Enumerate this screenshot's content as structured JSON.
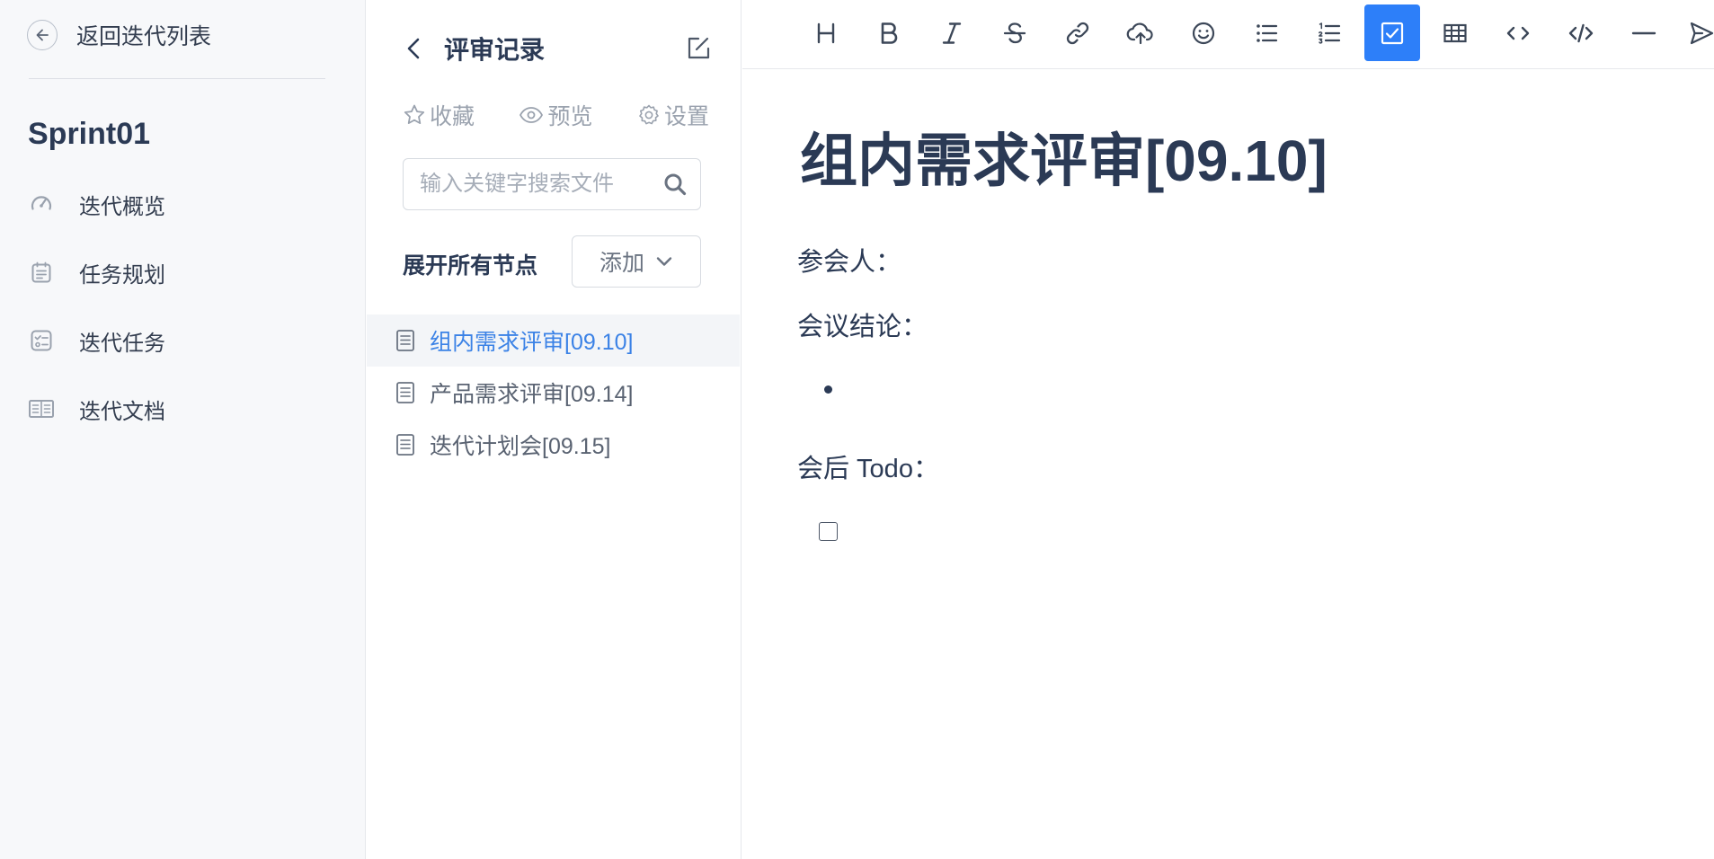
{
  "sidebar": {
    "back_label": "返回迭代列表",
    "sprint_title": "Sprint01",
    "items": [
      {
        "label": "迭代概览",
        "icon": "gauge-icon"
      },
      {
        "label": "任务规划",
        "icon": "calendar-list-icon"
      },
      {
        "label": "迭代任务",
        "icon": "checklist-icon"
      },
      {
        "label": "迭代文档",
        "icon": "book-icon"
      }
    ]
  },
  "tree_panel": {
    "title": "评审记录",
    "actions": {
      "favorite": "收藏",
      "preview": "预览",
      "settings": "设置"
    },
    "search": {
      "placeholder": "输入关键字搜索文件",
      "value": ""
    },
    "expand_all": "展开所有节点",
    "add_button": "添加",
    "documents": [
      {
        "title": "组内需求评审[09.10]",
        "active": true
      },
      {
        "title": "产品需求评审[09.14]",
        "active": false
      },
      {
        "title": "迭代计划会[09.15]",
        "active": false
      }
    ]
  },
  "toolbar": {
    "buttons": [
      "heading",
      "bold",
      "italic",
      "strikethrough",
      "link",
      "upload",
      "emoji",
      "bullet-list",
      "ordered-list",
      "task-list",
      "table",
      "inline-code",
      "code-block",
      "horizontal-rule",
      "send"
    ],
    "active": "task-list",
    "accent_color": "#2d7ff9"
  },
  "editor": {
    "title": "组内需求评审[09.10]",
    "attendees_label": "参会人：",
    "conclusion_label": "会议结论：",
    "todo_label": "会后 Todo："
  },
  "colors": {
    "accent": "#3b82e6",
    "text_dark": "#2b3a55",
    "sidebar_bg": "#f7f8fa"
  }
}
